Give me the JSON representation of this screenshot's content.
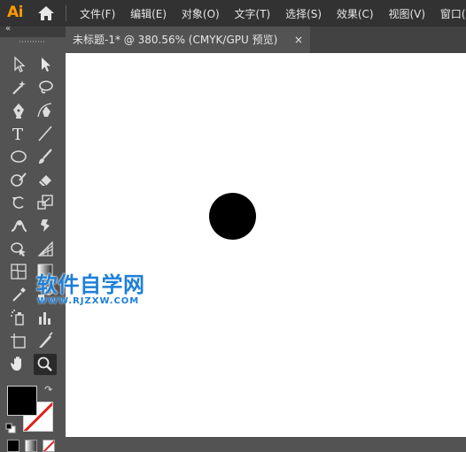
{
  "app": {
    "logo_text": "Ai",
    "logo_color": "#ff9a00"
  },
  "menu": {
    "items": [
      "文件(F)",
      "编辑(E)",
      "对象(O)",
      "文字(T)",
      "选择(S)",
      "效果(C)",
      "视图(V)",
      "窗口(W)"
    ]
  },
  "document_tab": {
    "title": "未标题-1* @ 380.56% (CMYK/GPU 预览)",
    "close_glyph": "×"
  },
  "toolbar": {
    "collapse_glyph": "«",
    "tools": [
      {
        "name": "selection-tool-icon"
      },
      {
        "name": "direct-selection-tool-icon"
      },
      {
        "name": "magic-wand-tool-icon"
      },
      {
        "name": "lasso-tool-icon"
      },
      {
        "name": "pen-tool-icon"
      },
      {
        "name": "curvature-tool-icon"
      },
      {
        "name": "type-tool-icon",
        "glyph": "T"
      },
      {
        "name": "line-segment-tool-icon"
      },
      {
        "name": "ellipse-tool-icon"
      },
      {
        "name": "paintbrush-tool-icon"
      },
      {
        "name": "shaper-tool-icon"
      },
      {
        "name": "eraser-tool-icon"
      },
      {
        "name": "rotate-tool-icon"
      },
      {
        "name": "scale-tool-icon"
      },
      {
        "name": "width-tool-icon"
      },
      {
        "name": "puppet-warp-tool-icon"
      },
      {
        "name": "shape-builder-tool-icon"
      },
      {
        "name": "perspective-grid-tool-icon"
      },
      {
        "name": "mesh-tool-icon"
      },
      {
        "name": "gradient-tool-icon"
      },
      {
        "name": "eyedropper-tool-icon"
      },
      {
        "name": "blend-tool-icon"
      },
      {
        "name": "symbol-sprayer-tool-icon"
      },
      {
        "name": "column-graph-tool-icon"
      },
      {
        "name": "artboard-tool-icon"
      },
      {
        "name": "slice-tool-icon"
      },
      {
        "name": "hand-tool-icon"
      },
      {
        "name": "zoom-tool-icon",
        "active": true
      }
    ],
    "fill_color": "#000000",
    "stroke_color": "none"
  },
  "canvas": {
    "background": "#ffffff",
    "shape": {
      "type": "circle",
      "fill": "#000000"
    }
  },
  "watermark": {
    "main": "软件自学网",
    "sub": "WWW.RJZXW.COM",
    "color": "#1e7fd8"
  }
}
